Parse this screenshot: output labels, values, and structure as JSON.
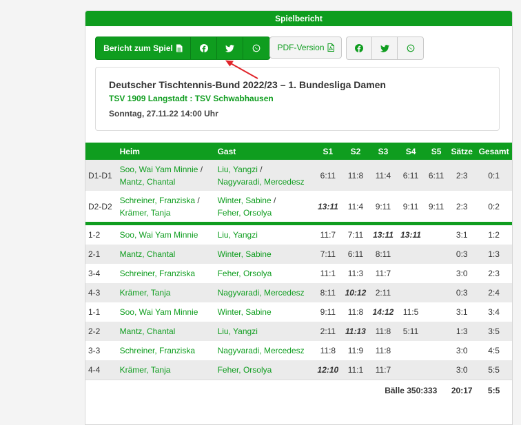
{
  "panel": {
    "title": "Spielbericht"
  },
  "toolbar": {
    "report_label": "Bericht zum Spiel",
    "pdf_label": "PDF-Version",
    "share_icons": [
      "facebook-icon",
      "twitter-icon",
      "whatsapp-icon"
    ]
  },
  "match": {
    "title": "Deutscher Tischtennis-Bund 2022/23 – 1. Bundesliga Damen",
    "teams": "TSV 1909 Langstadt : TSV Schwabhausen",
    "date": "Sonntag, 27.11.22 14:00 Uhr"
  },
  "table": {
    "headers": [
      "",
      "Heim",
      "Gast",
      "S1",
      "S2",
      "S3",
      "S4",
      "S5",
      "Sätze",
      "Gesamt"
    ],
    "doubles": [
      {
        "pos": "D1-D1",
        "home1": "Soo, Wai Yam Minnie",
        "home2": "Mantz, Chantal",
        "guest1": "Liu, Yangzi",
        "guest2": "Nagyvaradi, Mercedesz",
        "sets": [
          {
            "v": "6:11",
            "w": false
          },
          {
            "v": "11:8",
            "w": false
          },
          {
            "v": "11:4",
            "w": false
          },
          {
            "v": "6:11",
            "w": false
          },
          {
            "v": "6:11",
            "w": false
          }
        ],
        "saetze": "2:3",
        "gesamt": "0:1"
      },
      {
        "pos": "D2-D2",
        "home1": "Schreiner, Franziska",
        "home2": "Krämer, Tanja",
        "guest1": "Winter, Sabine",
        "guest2": "Feher, Orsolya",
        "sets": [
          {
            "v": "13:11",
            "w": true
          },
          {
            "v": "11:4",
            "w": false
          },
          {
            "v": "9:11",
            "w": false
          },
          {
            "v": "9:11",
            "w": false
          },
          {
            "v": "9:11",
            "w": false
          }
        ],
        "saetze": "2:3",
        "gesamt": "0:2"
      }
    ],
    "singles": [
      {
        "pos": "1-2",
        "home": "Soo, Wai Yam Minnie",
        "guest": "Liu, Yangzi",
        "sets": [
          {
            "v": "11:7",
            "w": false
          },
          {
            "v": "7:11",
            "w": false
          },
          {
            "v": "13:11",
            "w": true
          },
          {
            "v": "13:11",
            "w": true
          },
          {
            "v": "",
            "w": false
          }
        ],
        "saetze": "3:1",
        "gesamt": "1:2"
      },
      {
        "pos": "2-1",
        "home": "Mantz, Chantal",
        "guest": "Winter, Sabine",
        "sets": [
          {
            "v": "7:11",
            "w": false
          },
          {
            "v": "6:11",
            "w": false
          },
          {
            "v": "8:11",
            "w": false
          },
          {
            "v": "",
            "w": false
          },
          {
            "v": "",
            "w": false
          }
        ],
        "saetze": "0:3",
        "gesamt": "1:3"
      },
      {
        "pos": "3-4",
        "home": "Schreiner, Franziska",
        "guest": "Feher, Orsolya",
        "sets": [
          {
            "v": "11:1",
            "w": false
          },
          {
            "v": "11:3",
            "w": false
          },
          {
            "v": "11:7",
            "w": false
          },
          {
            "v": "",
            "w": false
          },
          {
            "v": "",
            "w": false
          }
        ],
        "saetze": "3:0",
        "gesamt": "2:3"
      },
      {
        "pos": "4-3",
        "home": "Krämer, Tanja",
        "guest": "Nagyvaradi, Mercedesz",
        "sets": [
          {
            "v": "8:11",
            "w": false
          },
          {
            "v": "10:12",
            "w": true
          },
          {
            "v": "2:11",
            "w": false
          },
          {
            "v": "",
            "w": false
          },
          {
            "v": "",
            "w": false
          }
        ],
        "saetze": "0:3",
        "gesamt": "2:4"
      },
      {
        "pos": "1-1",
        "home": "Soo, Wai Yam Minnie",
        "guest": "Winter, Sabine",
        "sets": [
          {
            "v": "9:11",
            "w": false
          },
          {
            "v": "11:8",
            "w": false
          },
          {
            "v": "14:12",
            "w": true
          },
          {
            "v": "11:5",
            "w": false
          },
          {
            "v": "",
            "w": false
          }
        ],
        "saetze": "3:1",
        "gesamt": "3:4"
      },
      {
        "pos": "2-2",
        "home": "Mantz, Chantal",
        "guest": "Liu, Yangzi",
        "sets": [
          {
            "v": "2:11",
            "w": false
          },
          {
            "v": "11:13",
            "w": true
          },
          {
            "v": "11:8",
            "w": false
          },
          {
            "v": "5:11",
            "w": false
          },
          {
            "v": "",
            "w": false
          }
        ],
        "saetze": "1:3",
        "gesamt": "3:5"
      },
      {
        "pos": "3-3",
        "home": "Schreiner, Franziska",
        "guest": "Nagyvaradi, Mercedesz",
        "sets": [
          {
            "v": "11:8",
            "w": false
          },
          {
            "v": "11:9",
            "w": false
          },
          {
            "v": "11:8",
            "w": false
          },
          {
            "v": "",
            "w": false
          },
          {
            "v": "",
            "w": false
          }
        ],
        "saetze": "3:0",
        "gesamt": "4:5"
      },
      {
        "pos": "4-4",
        "home": "Krämer, Tanja",
        "guest": "Feher, Orsolya",
        "sets": [
          {
            "v": "12:10",
            "w": true
          },
          {
            "v": "11:1",
            "w": false
          },
          {
            "v": "11:7",
            "w": false
          },
          {
            "v": "",
            "w": false
          },
          {
            "v": "",
            "w": false
          }
        ],
        "saetze": "3:0",
        "gesamt": "5:5"
      }
    ],
    "summary": {
      "balls": "Bälle 350:333",
      "saetze": "20:17",
      "gesamt": "5:5"
    }
  },
  "colors": {
    "accent": "#0f9d1f",
    "annotation_arrow": "#e0242a"
  }
}
